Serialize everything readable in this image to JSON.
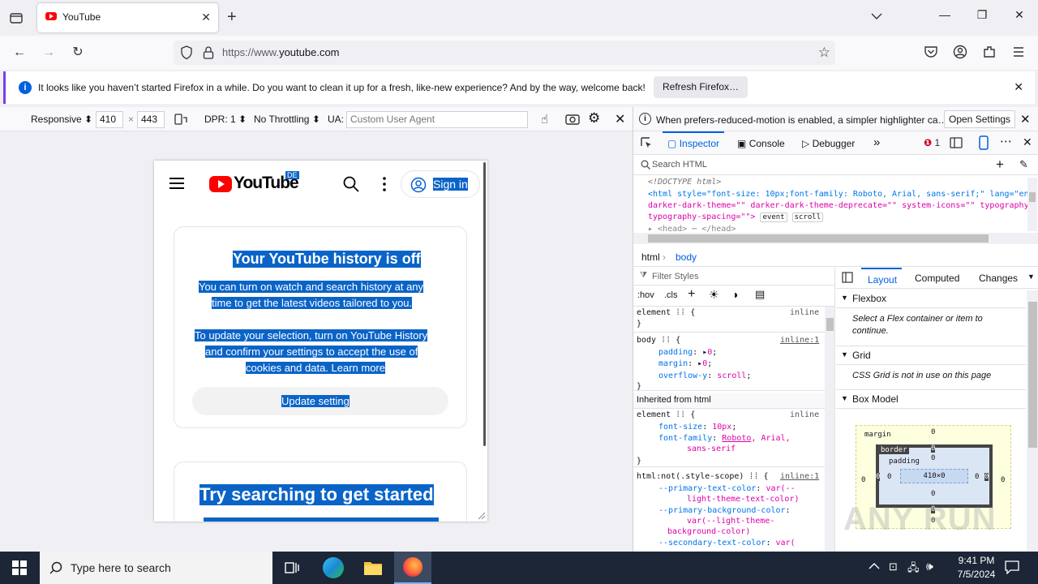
{
  "browser": {
    "tab_title": "YouTube",
    "url_prefix": "https://www.",
    "url_domain": "youtube.com",
    "notification_text": "It looks like you haven’t started Firefox in a while. Do you want to clean it up for a fresh, like-new experience? And by the way, welcome back!",
    "notification_button": "Refresh Firefox…",
    "accent": "#7542e5"
  },
  "rdm": {
    "device": "Responsive",
    "width": "410",
    "times": "×",
    "height": "443",
    "dpr": "DPR: 1",
    "throttling": "No Throttling",
    "ua_label": "UA:",
    "ua_placeholder": "Custom User Agent"
  },
  "page": {
    "logo_text": "YouTube",
    "logo_badge": "DE",
    "sign_in": "Sign in",
    "history_title": "Your YouTube history is off",
    "history_line1": "You can turn on watch and search history at any",
    "history_line2": "time to get the latest videos tailored to you.",
    "update_line1": "To update your selection, turn on YouTube History",
    "update_line2": "and confirm your settings to accept the use of",
    "update_line3": "cookies and data. Learn more",
    "update_button": "Update setting",
    "try_title": "Try searching to get started"
  },
  "devtools": {
    "notice": "When prefers-reduced-motion is enabled, a simpler highlighter ca…",
    "notice_button": "Open Settings",
    "tabs": {
      "inspector": "Inspector",
      "console": "Console",
      "debugger": "Debugger"
    },
    "error_count": "1",
    "search_placeholder": "Search HTML",
    "markup": {
      "doctype": "<!DOCTYPE html>",
      "html_line": "<html style=\"font-size: 10px;font-family: Roboto, Arial, sans-serif;\" lang=\"en\"",
      "line2": "darker-dark-theme=\"\" darker-dark-theme-deprecate=\"\" system-icons=\"\" typography",
      "line3": "typography-spacing=\"\">",
      "event_badge": "event",
      "scroll_badge": "scroll",
      "head_line": "▸ <head> ⋯ </head>"
    },
    "breadcrumb": [
      "html",
      "body"
    ],
    "filter_placeholder": "Filter Styles",
    "hov": ":hov",
    "cls": ".cls",
    "rules": {
      "element": "element",
      "inline": "inline",
      "body_selector": "body",
      "inline1": "inline:1",
      "padding": "padding",
      "padding_val": "0",
      "margin": "margin",
      "margin_val": "0",
      "overflow": "overflow-y",
      "overflow_val": "scroll",
      "inherited": "Inherited from html",
      "font_size": "font-size",
      "font_size_val": "10px",
      "font_family": "font-family",
      "font_family_val1": "Roboto",
      "font_family_val2": ", Arial,",
      "font_family_val3": "sans-serif",
      "html_selector": "html:not(.style-scope)",
      "var1": "--primary-text-color",
      "var1_val1": "var(--",
      "var1_val2": "light-theme-text-color)",
      "var2": "--primary-background-color",
      "var2_val1": "var(--light-theme-",
      "var2_val2": "background-color)",
      "var3": "--secondary-text-color",
      "var3_val": "var("
    },
    "layout_tabs": {
      "layout": "Layout",
      "computed": "Computed",
      "changes": "Changes"
    },
    "flexbox": "Flexbox",
    "flexbox_msg": "Select a Flex container or item to continue.",
    "grid": "Grid",
    "grid_msg": "CSS Grid is not in use on this page",
    "box_model": "Box Model",
    "bm": {
      "margin": "margin",
      "border": "border",
      "padding": "padding",
      "content": "410×0",
      "zero": "0"
    }
  },
  "taskbar": {
    "search_placeholder": "Type here to search",
    "time": "9:41 PM",
    "date": "7/5/2024"
  },
  "watermark": "ANY RUN"
}
